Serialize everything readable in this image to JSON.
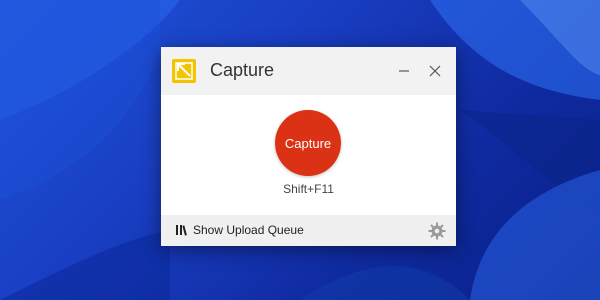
{
  "window": {
    "title": "Capture"
  },
  "main": {
    "capture_button_label": "Capture",
    "shortcut": "Shift+F11"
  },
  "footer": {
    "upload_queue_label": "Show Upload Queue"
  },
  "icons": {
    "app": "capture-app-icon",
    "minimize": "minimize-icon",
    "close": "close-icon",
    "queue": "upload-queue-icon",
    "settings": "gear-icon"
  },
  "colors": {
    "capture_button": "#db3114",
    "app_icon": "#f5c400",
    "wallpaper": "#1a3fc4"
  }
}
